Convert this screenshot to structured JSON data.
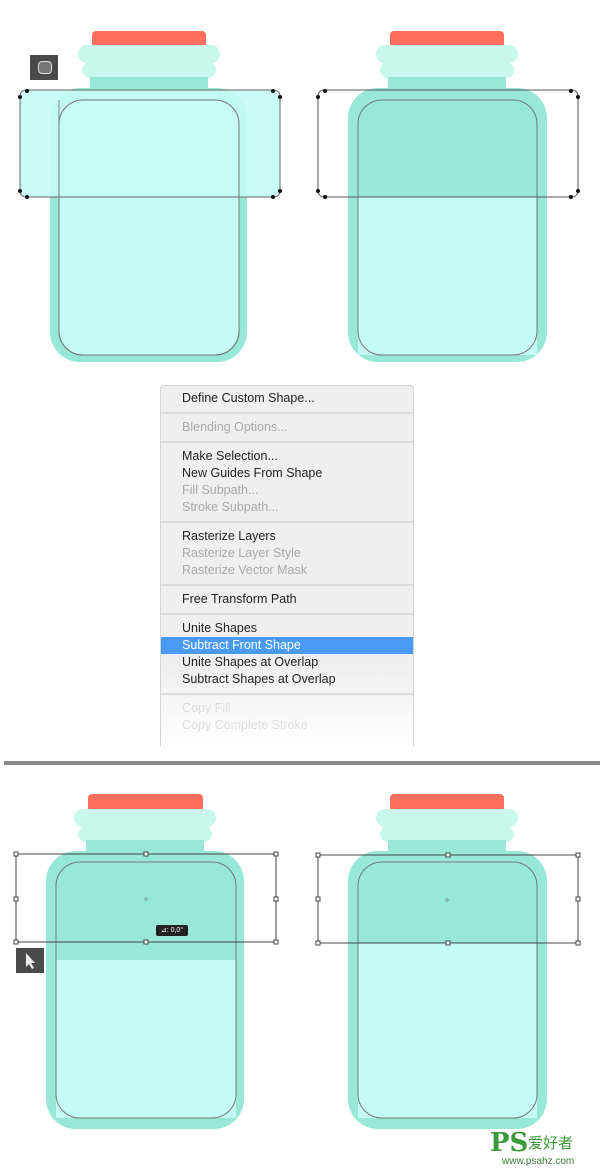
{
  "colors": {
    "lid": "#fd6f5c",
    "ring": "#c9f7ec",
    "body": "#98e8d6",
    "inner": "#c5fbf6",
    "selection": "#4a9bf8"
  },
  "menu": {
    "items": [
      {
        "label": "Define Custom Shape...",
        "enabled": true
      },
      {
        "label": "Blending Options...",
        "enabled": false
      },
      {
        "label": "Make Selection...",
        "enabled": true
      },
      {
        "label": "New Guides From Shape",
        "enabled": true
      },
      {
        "label": "Fill Subpath...",
        "enabled": false
      },
      {
        "label": "Stroke Subpath...",
        "enabled": false
      },
      {
        "label": "Rasterize Layers",
        "enabled": true
      },
      {
        "label": "Rasterize Layer Style",
        "enabled": false
      },
      {
        "label": "Rasterize Vector Mask",
        "enabled": false
      },
      {
        "label": "Free Transform Path",
        "enabled": true
      },
      {
        "label": "Unite Shapes",
        "enabled": true
      },
      {
        "label": "Subtract Front Shape",
        "enabled": true,
        "selected": true
      },
      {
        "label": "Unite Shapes at Overlap",
        "enabled": true
      },
      {
        "label": "Subtract Shapes at Overlap",
        "enabled": true
      },
      {
        "label": "Copy Fill",
        "enabled": false
      },
      {
        "label": "Copy Complete Stroke",
        "enabled": false
      }
    ]
  },
  "rotation_readout": "⊿: 0,0°",
  "tools": {
    "top": "rounded-rectangle-tool-icon",
    "bottom": "path-selection-tool-icon"
  },
  "watermark": {
    "logo": "PS",
    "cn": "爱好者",
    "url": "www.psahz.com"
  }
}
